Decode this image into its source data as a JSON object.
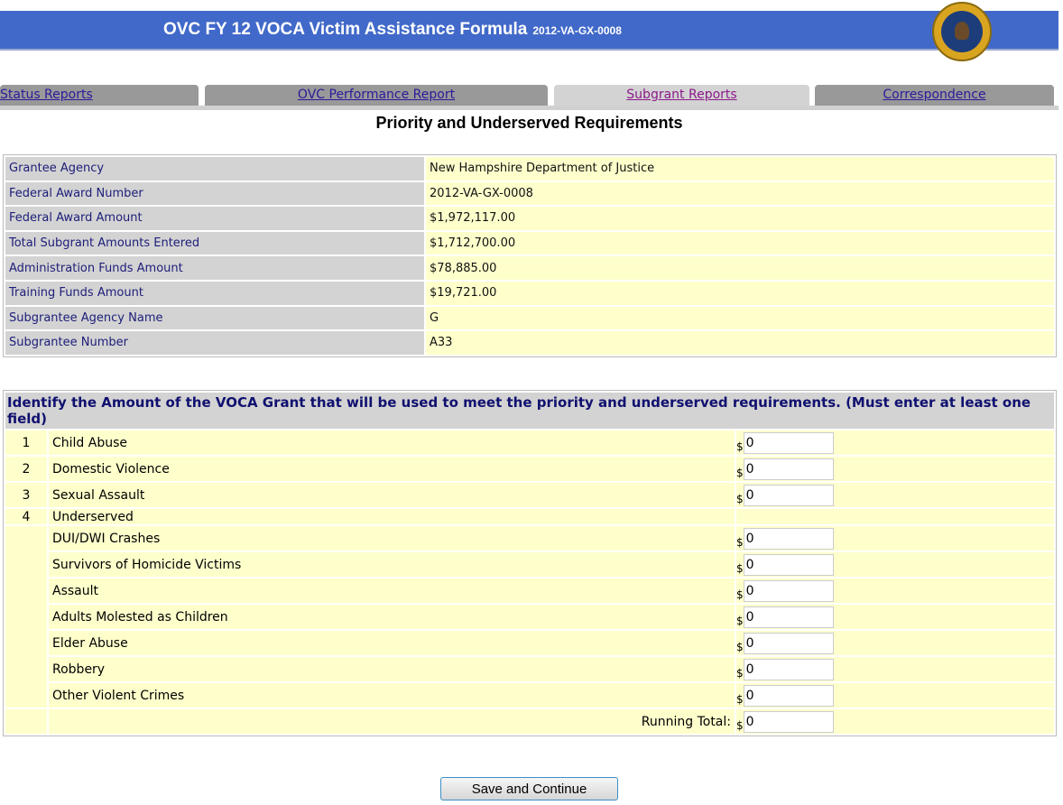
{
  "header": {
    "title": "OVC FY 12 VOCA Victim Assistance Formula",
    "award": "2012-VA-GX-0008",
    "seal": "U.S. Department of Justice Office of Justice Programs"
  },
  "tabs": [
    "Status Reports",
    "OVC Performance Report",
    "Subgrant Reports",
    "Correspondence"
  ],
  "page_title": "Priority and Underserved Requirements",
  "info": [
    [
      "Grantee Agency",
      "New Hampshire Department of Justice"
    ],
    [
      "Federal Award Number",
      "2012-VA-GX-0008"
    ],
    [
      "Federal Award Amount",
      "$1,972,117.00"
    ],
    [
      "Total Subgrant Amounts Entered",
      "$1,712,700.00"
    ],
    [
      "Administration Funds Amount",
      "$78,885.00"
    ],
    [
      "Training Funds Amount",
      "$19,721.00"
    ],
    [
      "Subgrantee Agency Name",
      "G"
    ],
    [
      "Subgrantee Number",
      "A33"
    ]
  ],
  "req": {
    "heading": "Identify the Amount of the VOCA Grant that will be used to meet the priority and underserved requirements. (Must enter at least one field)",
    "currency": "$",
    "rows": [
      {
        "n": "1",
        "label": "Child Abuse",
        "value": "0"
      },
      {
        "n": "2",
        "label": "Domestic Violence",
        "value": "0"
      },
      {
        "n": "3",
        "label": "Sexual Assault",
        "value": "0"
      }
    ],
    "underserved": {
      "n": "4",
      "label": "Underserved"
    },
    "sub": [
      {
        "label": "DUI/DWI Crashes",
        "value": "0"
      },
      {
        "label": "Survivors of Homicide Victims",
        "value": "0"
      },
      {
        "label": "Assault",
        "value": "0"
      },
      {
        "label": "Adults Molested as Children",
        "value": "0"
      },
      {
        "label": "Elder Abuse",
        "value": "0"
      },
      {
        "label": "Robbery",
        "value": "0"
      },
      {
        "label": "Other Violent Crimes",
        "value": "0"
      }
    ],
    "total_label": "Running Total:",
    "total_value": "0"
  },
  "button": "Save and Continue"
}
